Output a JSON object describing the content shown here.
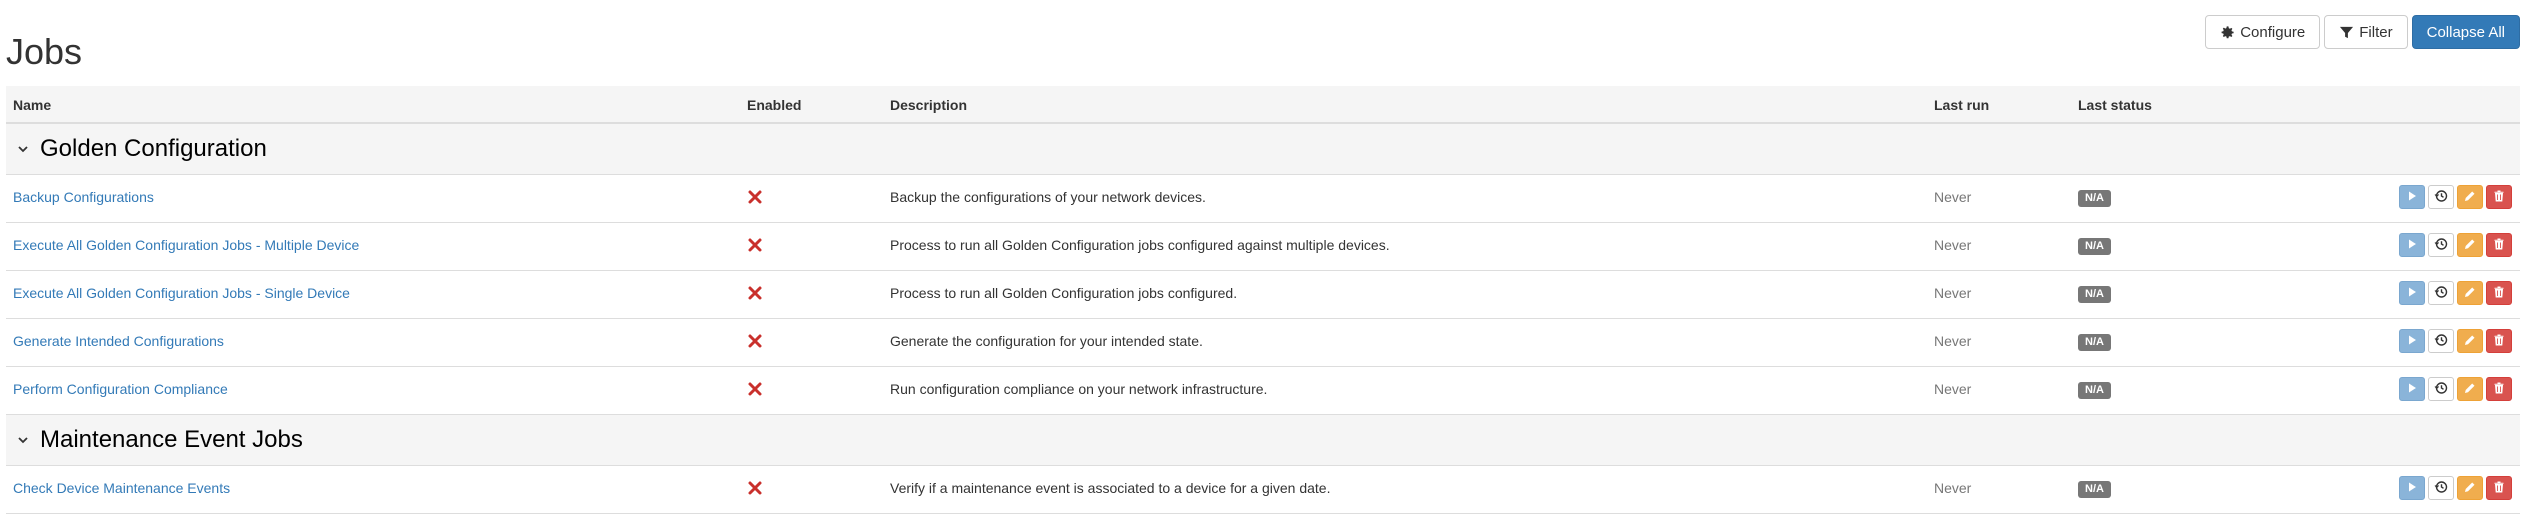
{
  "page": {
    "title": "Jobs"
  },
  "toolbar": {
    "configure_label": "Configure",
    "filter_label": "Filter",
    "collapse_label": "Collapse All"
  },
  "table": {
    "headers": {
      "name": "Name",
      "enabled": "Enabled",
      "description": "Description",
      "last_run": "Last run",
      "last_status": "Last status"
    },
    "groups": [
      {
        "title": "Golden Configuration",
        "jobs": [
          {
            "name": "Backup Configurations",
            "description": "Backup the configurations of your network devices.",
            "last_run": "Never",
            "status": "N/A"
          },
          {
            "name": "Execute All Golden Configuration Jobs - Multiple Device",
            "description": "Process to run all Golden Configuration jobs configured against multiple devices.",
            "last_run": "Never",
            "status": "N/A"
          },
          {
            "name": "Execute All Golden Configuration Jobs - Single Device",
            "description": "Process to run all Golden Configuration jobs configured.",
            "last_run": "Never",
            "status": "N/A"
          },
          {
            "name": "Generate Intended Configurations",
            "description": "Generate the configuration for your intended state.",
            "last_run": "Never",
            "status": "N/A"
          },
          {
            "name": "Perform Configuration Compliance",
            "description": "Run configuration compliance on your network infrastructure.",
            "last_run": "Never",
            "status": "N/A"
          }
        ]
      },
      {
        "title": "Maintenance Event Jobs",
        "jobs": [
          {
            "name": "Check Device Maintenance Events",
            "description": "Verify if a maintenance event is associated to a device for a given date.",
            "last_run": "Never",
            "status": "N/A"
          }
        ]
      }
    ]
  },
  "colors": {
    "primary": "#337ab7",
    "disabled_x": "#c9302c",
    "run": "#8ab4d9",
    "edit": "#f0ad4e",
    "delete": "#d9534f",
    "badge": "#777777"
  }
}
